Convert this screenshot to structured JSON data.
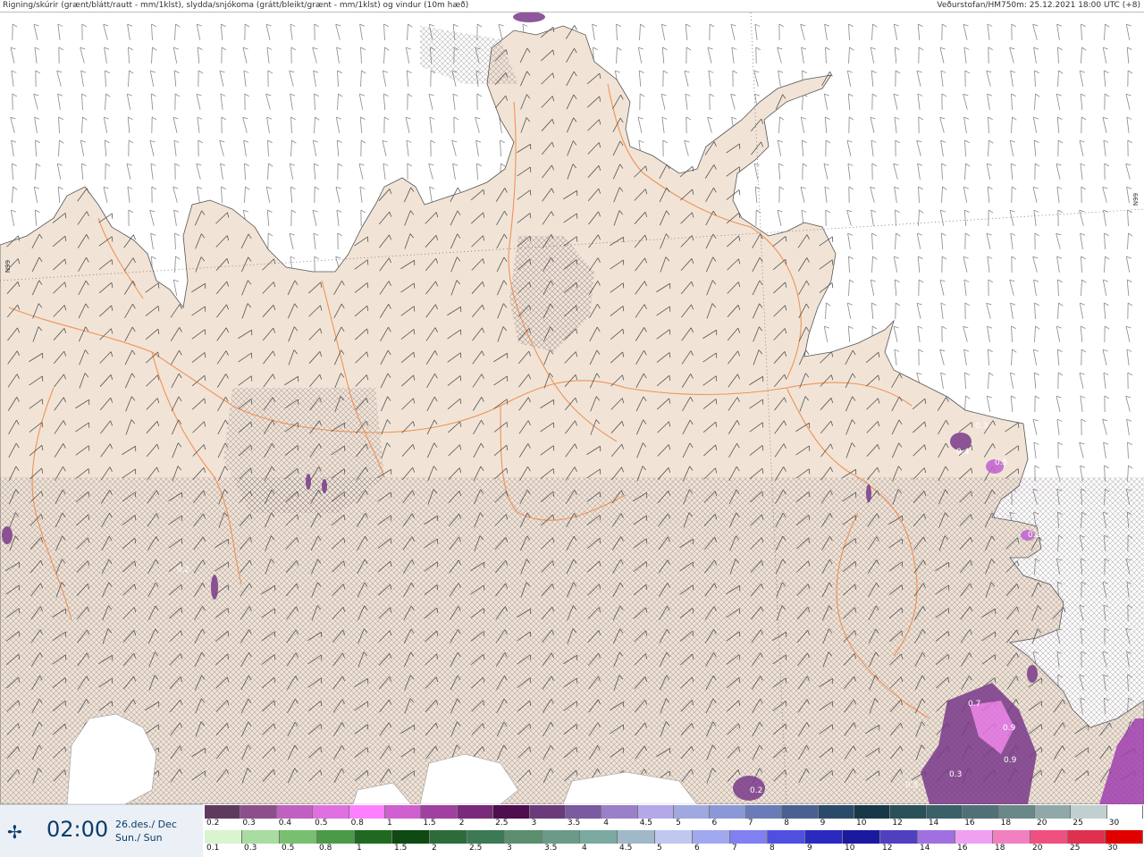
{
  "header": {
    "left": "Rigning/skúrir (grænt/blátt/rautt - mm/1klst), slydda/snjókoma (grátt/bleikt/grænt - mm/1klst) og vindur (10m hæð)",
    "right": "Veðurstofan/HM750m: 25.12.2021 18:00 UTC (+8)"
  },
  "map": {
    "grid_label_left": "N99",
    "grid_label_right": "N99",
    "land_color": "#f1e4d6",
    "sea_color": "#ffffff",
    "road_color": "#f08a4b",
    "precip_labels": [
      "0.3",
      "0.4",
      "0.5",
      "0.2",
      "0.5",
      "0.7",
      "0.9",
      "0.9",
      "0.3",
      "0.2",
      "0.2"
    ]
  },
  "footer": {
    "time": "02:00",
    "date_line1": "26.des./ Dec",
    "date_line2": "Sun./ Sun",
    "snow_scale": {
      "labels": [
        "0.2",
        "0.3",
        "0.4",
        "0.5",
        "0.8",
        "1",
        "1.5",
        "2",
        "2.5",
        "3",
        "3.5",
        "4",
        "4.5",
        "5",
        "6",
        "7",
        "8",
        "9",
        "10",
        "12",
        "14",
        "16",
        "18",
        "20",
        "25",
        "30"
      ],
      "colors": [
        "#5e3a5e",
        "#8c4f8c",
        "#c060c0",
        "#e070e0",
        "#ff80ff",
        "#d060d0",
        "#a040a0",
        "#7a2a7a",
        "#4d0f4d",
        "#6b3a7a",
        "#7a5aa0",
        "#9a80c8",
        "#b4a8e8",
        "#a0a8e0",
        "#8a98d8",
        "#6a7cb8",
        "#4a6090",
        "#2a4a6a",
        "#183848",
        "#2a5058",
        "#3a6068",
        "#507078",
        "#6a8888",
        "#90a8a8",
        "#c0d0d0",
        "#ffffff"
      ]
    },
    "rain_scale": {
      "labels": [
        "0.1",
        "0.3",
        "0.5",
        "0.8",
        "1",
        "1.5",
        "2",
        "2.5",
        "3",
        "3.5",
        "4",
        "4.5",
        "5",
        "6",
        "7",
        "8",
        "9",
        "10",
        "12",
        "14",
        "16",
        "18",
        "20",
        "25",
        "30"
      ],
      "colors": [
        "#d8f5d0",
        "#a8dca0",
        "#78c070",
        "#4a9a48",
        "#1f6a20",
        "#0e4a12",
        "#2e6b3a",
        "#3c7a55",
        "#5a8e6e",
        "#6a9a88",
        "#7aaaa0",
        "#a0b8c8",
        "#c0c8f0",
        "#a0a8f0",
        "#8080f0",
        "#5050e0",
        "#2a2ac0",
        "#1a1aa0",
        "#5040c0",
        "#a070e0",
        "#f0a0f0",
        "#f080c0",
        "#f05080",
        "#e03050",
        "#e00000"
      ]
    }
  }
}
